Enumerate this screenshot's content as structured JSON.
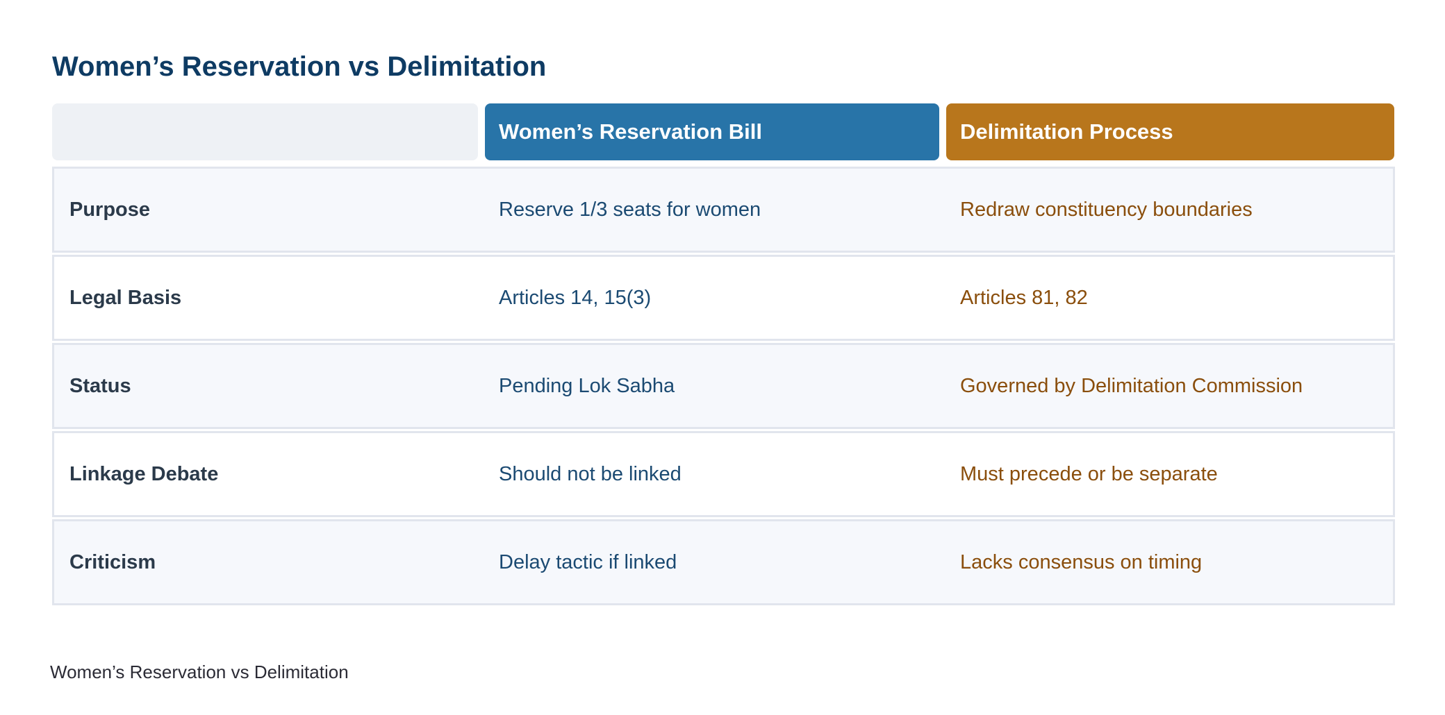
{
  "title": "Women’s Reservation vs Delimitation",
  "columns": {
    "blank": "",
    "bill": "Women’s Reservation Bill",
    "delimitation": "Delimitation Process"
  },
  "rows": [
    {
      "label": "Purpose",
      "bill": "Reserve 1/3 seats for women",
      "delimitation": "Redraw constituency boundaries"
    },
    {
      "label": "Legal Basis",
      "bill": "Articles 14, 15(3)",
      "delimitation": "Articles 81, 82"
    },
    {
      "label": "Status",
      "bill": "Pending Lok Sabha",
      "delimitation": "Governed by Delimitation Commission"
    },
    {
      "label": "Linkage Debate",
      "bill": "Should not be linked",
      "delimitation": "Must precede or be separate"
    },
    {
      "label": "Criticism",
      "bill": "Delay tactic if linked",
      "delimitation": "Lacks consensus on timing"
    }
  ],
  "caption": "Women’s Reservation vs Delimitation",
  "colors": {
    "title": "#0e3b63",
    "bill_header": "#2874a8",
    "delimitation_header": "#b8761c",
    "bill_text": "#1b4a72",
    "delimitation_text": "#8a4e0c"
  }
}
